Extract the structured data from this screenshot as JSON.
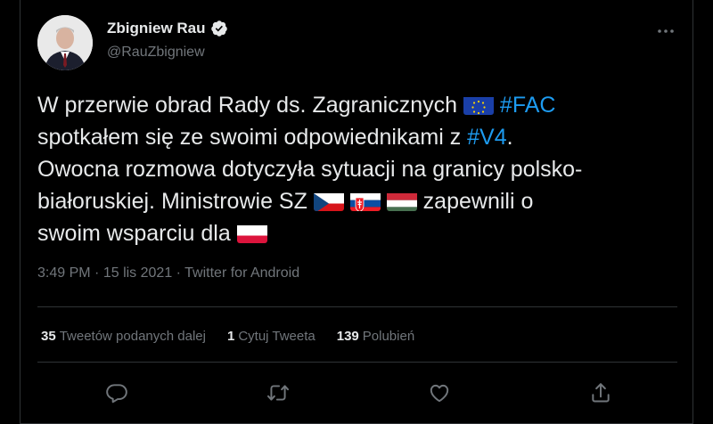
{
  "author": {
    "name": "Zbigniew Rau",
    "handle": "@RauZbigniew",
    "verified": true
  },
  "tweet": {
    "line1_pre": "W przerwie obrad Rady ds. Zagranicznych ",
    "hashtag_fac": "#FAC",
    "line2_pre": "spotkałem się ze swoimi odpowiednikami z ",
    "hashtag_v4": "#V4",
    "line2_post": ".",
    "line3": "Owocna rozmowa dotyczyła sytuacji na granicy polsko-",
    "line4_pre": "białoruskiej. Ministrowie SZ ",
    "line4_post": " zapewnili o",
    "line5_pre": "swoim wsparciu dla ",
    "flags": [
      "EU",
      "CZ",
      "SK",
      "HU",
      "PL"
    ]
  },
  "meta": {
    "time": "3:49 PM",
    "date": "15 lis 2021",
    "source": "Twitter for Android",
    "separator": "·"
  },
  "stats": {
    "retweets_count": "35",
    "retweets_label": "Tweetów podanych dalej",
    "quotes_count": "1",
    "quotes_label": "Cytuj Tweeta",
    "likes_count": "139",
    "likes_label": "Polubień"
  },
  "icons": [
    "avatar",
    "verified-badge-icon",
    "more-options-icon",
    "reply-icon",
    "retweet-icon",
    "like-icon",
    "share-icon"
  ],
  "colors": {
    "background": "#000000",
    "text": "#e7e9ea",
    "secondary": "#71767b",
    "link": "#1d9bf0",
    "border": "#2f3336"
  }
}
